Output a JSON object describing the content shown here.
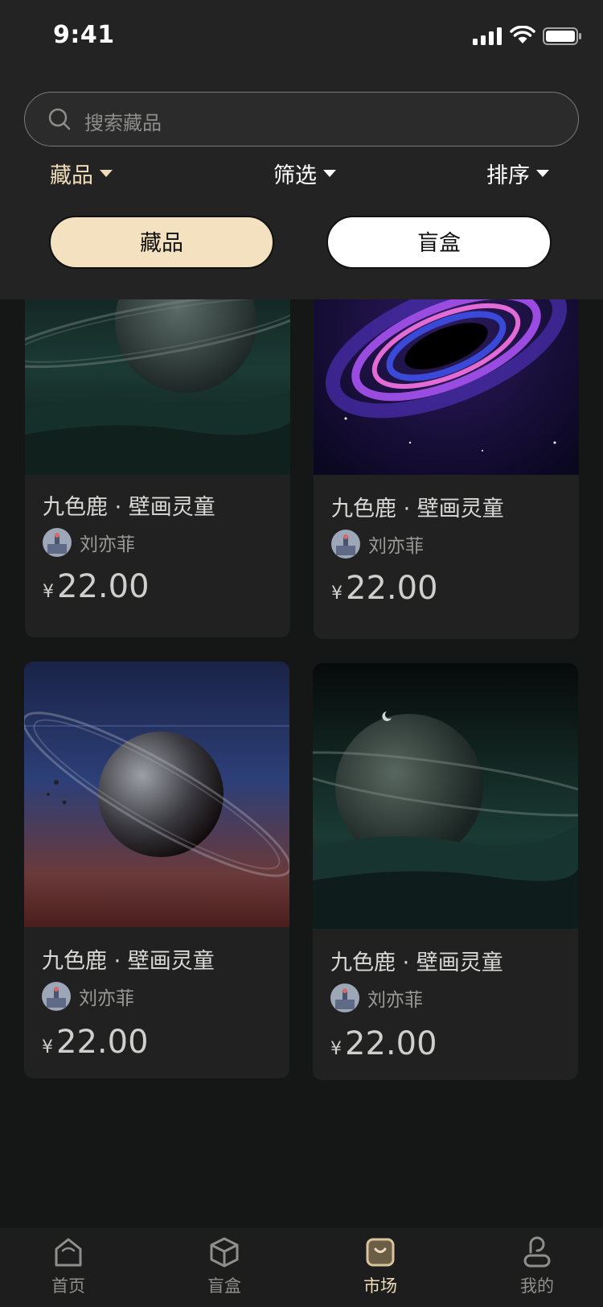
{
  "status_bar": {
    "time": "9:41"
  },
  "search": {
    "placeholder": "搜索藏品"
  },
  "filters": [
    {
      "label": "藏品",
      "active": true
    },
    {
      "label": "筛选",
      "active": false
    },
    {
      "label": "排序",
      "active": false
    }
  ],
  "segment_tabs": [
    {
      "label": "藏品",
      "selected": true
    },
    {
      "label": "盲盒",
      "selected": false
    }
  ],
  "items": [
    {
      "title": "九色鹿 · 壁画灵童",
      "author": "刘亦菲",
      "currency": "¥",
      "price": "22.00",
      "image": "ringed-planet-green"
    },
    {
      "title": "九色鹿 · 壁画灵童",
      "author": "刘亦菲",
      "currency": "¥",
      "price": "22.00",
      "image": "black-hole-purple"
    },
    {
      "title": "九色鹿 · 壁画灵童",
      "author": "刘亦菲",
      "currency": "¥",
      "price": "22.00",
      "image": "ringed-planet-red"
    },
    {
      "title": "九色鹿 · 壁画灵童",
      "author": "刘亦菲",
      "currency": "¥",
      "price": "22.00",
      "image": "ringed-planet-green"
    }
  ],
  "bottom_nav": [
    {
      "label": "首页",
      "icon": "home-icon",
      "active": false
    },
    {
      "label": "盲盒",
      "icon": "box-icon",
      "active": false
    },
    {
      "label": "市场",
      "icon": "bag-icon",
      "active": true
    },
    {
      "label": "我的",
      "icon": "user-icon",
      "active": false
    }
  ],
  "colors": {
    "accent": "#f0dcb8",
    "background": "#151716",
    "header": "#222322",
    "card": "#202120"
  }
}
